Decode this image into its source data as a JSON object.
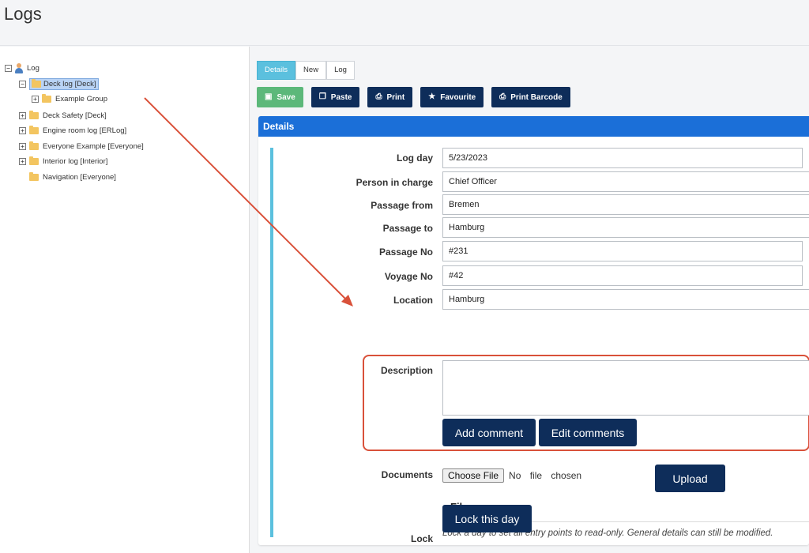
{
  "page": {
    "title": "Logs"
  },
  "tree": {
    "root": {
      "label": "Log",
      "toggle": "−"
    },
    "items": [
      {
        "label": "Deck log [Deck]",
        "toggle": "−"
      },
      {
        "label": "Example Group",
        "toggle": "+"
      },
      {
        "label": "Deck Safety [Deck]",
        "toggle": "+"
      },
      {
        "label": "Engine room log [ERLog]",
        "toggle": "+"
      },
      {
        "label": "Everyone Example [Everyone]",
        "toggle": "+"
      },
      {
        "label": "Interior log [Interior]",
        "toggle": "+"
      },
      {
        "label": "Navigation [Everyone]"
      }
    ]
  },
  "tabs": [
    {
      "label": "Details"
    },
    {
      "label": "New"
    },
    {
      "label": "Log"
    }
  ],
  "toolbar": {
    "save": "Save",
    "paste": "Paste",
    "print": "Print",
    "favourite": "Favourite",
    "print_barcode": "Print Barcode"
  },
  "details": {
    "header": "Details",
    "fields": {
      "log_day": {
        "label": "Log day",
        "value": "5/23/2023"
      },
      "person_in_charge": {
        "label": "Person in charge",
        "value": "Chief Officer"
      },
      "passage_from": {
        "label": "Passage from",
        "value": "Bremen"
      },
      "passage_to": {
        "label": "Passage to",
        "value": "Hamburg"
      },
      "passage_no": {
        "label": "Passage No",
        "value": "#231"
      },
      "voyage_no": {
        "label": "Voyage No",
        "value": "#42"
      },
      "location": {
        "label": "Location",
        "value": "Hamburg"
      }
    },
    "description": {
      "label": "Description",
      "value": "",
      "add_comment": "Add comment",
      "edit_comments": "Edit comments"
    },
    "documents": {
      "label": "Documents",
      "choose_file": "Choose File",
      "file_status": "No file chosen",
      "upload": "Upload",
      "filename_header": "Filename"
    },
    "lock": {
      "label": "Lock",
      "description": "Lock a day to set all entry points to read-only. General details can still be modified.",
      "button": "Lock this day"
    }
  },
  "colors": {
    "primary_dark": "#0e2d5a",
    "save_green": "#5cb87a",
    "tab_active": "#5bc0de",
    "details_header": "#1b6fd8",
    "annotation_red": "#d9513a"
  }
}
